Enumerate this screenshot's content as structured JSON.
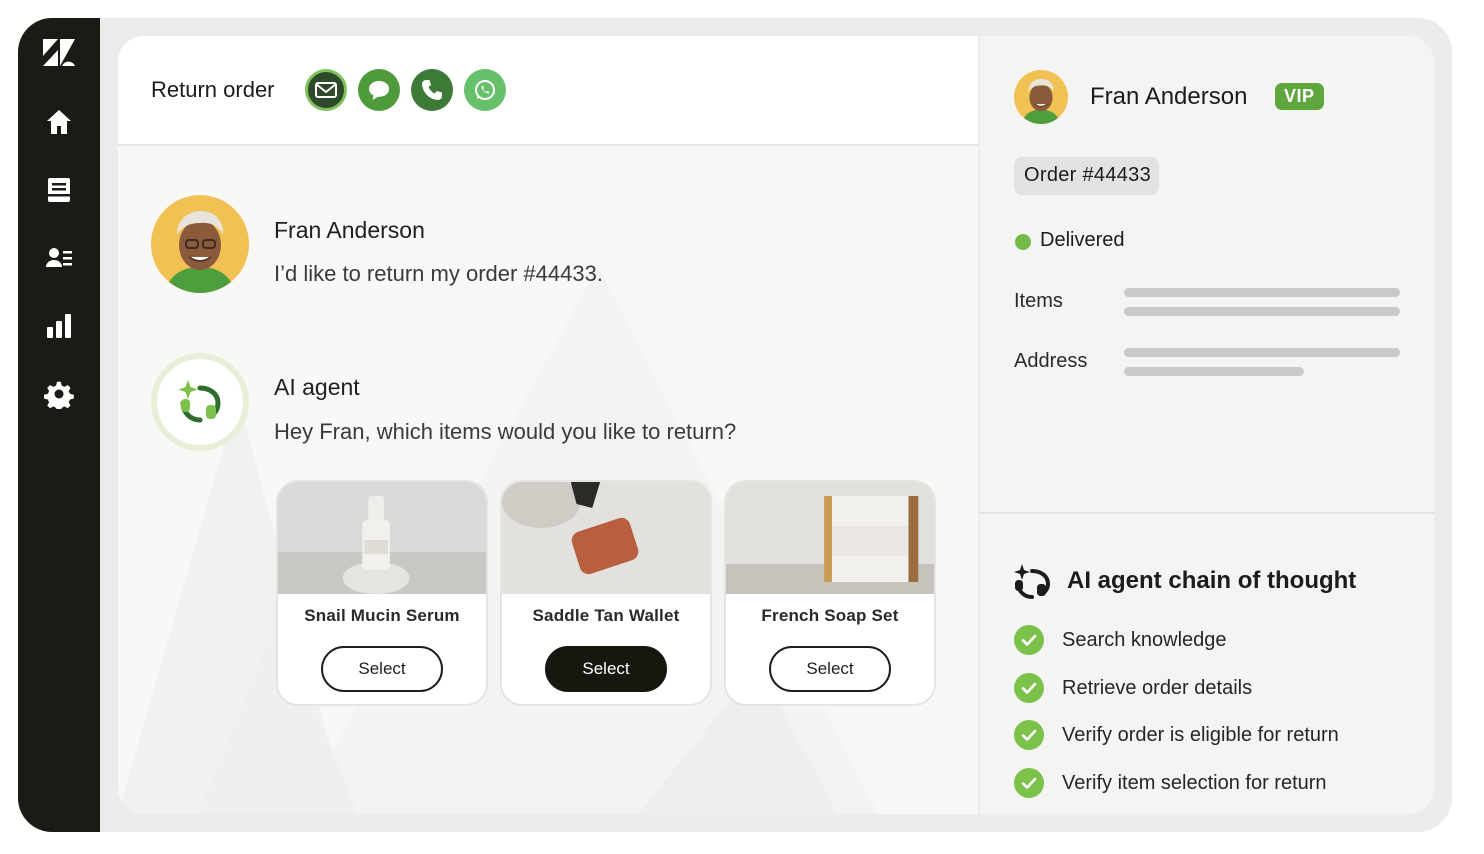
{
  "main_header": {
    "title": "Return order",
    "channels": [
      {
        "icon": "email-icon",
        "color": "#2f4a2a"
      },
      {
        "icon": "chat-icon",
        "color": "#4f9a3a"
      },
      {
        "icon": "phone-icon",
        "color": "#3d7a35"
      },
      {
        "icon": "whatsapp-icon",
        "color": "#67c06a"
      }
    ]
  },
  "sidebar": {
    "items": [
      {
        "icon": "zendesk-logo-icon"
      },
      {
        "icon": "home-icon"
      },
      {
        "icon": "inbox-icon"
      },
      {
        "icon": "contacts-icon"
      },
      {
        "icon": "reports-icon"
      },
      {
        "icon": "settings-icon"
      }
    ]
  },
  "conversation": {
    "customer_message": {
      "author": "Fran Anderson",
      "text": "I’d like to return my order #44433."
    },
    "agent_message": {
      "author": "AI agent",
      "text": "Hey Fran, which items would you like to return?"
    },
    "products": [
      {
        "name": "Snail Mucin Serum",
        "button": "Select",
        "selected": false
      },
      {
        "name": "Saddle Tan Wallet",
        "button": "Select",
        "selected": true
      },
      {
        "name": "French Soap Set",
        "button": "Select",
        "selected": false
      }
    ]
  },
  "customer_panel": {
    "name": "Fran Anderson",
    "badge": "VIP",
    "order": "Order #44433",
    "status": "Delivered",
    "fields": {
      "items_label": "Items",
      "address_label": "Address"
    }
  },
  "chain_of_thought": {
    "title": "AI agent chain of thought",
    "steps": [
      "Search knowledge",
      "Retrieve order details",
      "Verify order is eligible for return",
      "Verify item selection for return"
    ]
  },
  "colors": {
    "sidebar": "#1c1a15",
    "accent_green": "#72ba4a",
    "vip": "#5fa63f",
    "selected_button": "#17170f"
  }
}
